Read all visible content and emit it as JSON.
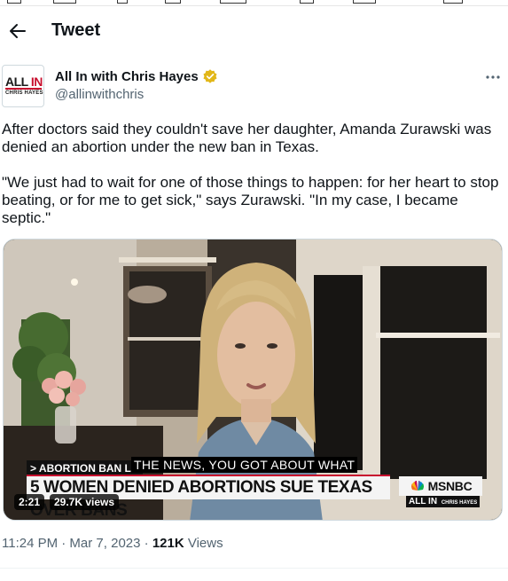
{
  "header": {
    "title": "Tweet",
    "back_icon": "arrow-left-icon"
  },
  "author": {
    "name": "All In with Chris Hayes",
    "handle": "@allinwithchris",
    "verified_icon": "verified-badge-icon",
    "verified_color": "#e2b719",
    "avatar": {
      "logo_top": "ALL IN",
      "logo_bottom": "CHRIS HAYES"
    },
    "more_icon": "more-dots-icon"
  },
  "tweet": {
    "paragraphs": [
      "After doctors said they couldn't save her daughter, Amanda Zurawski was denied an abortion under the new ban in Texas.",
      "\"We just had to wait for one of those things to happen: for her heart to stop beating, or for me to get sick,\" says Zurawski. \"In my case, I became septic.\""
    ]
  },
  "video": {
    "tag": "> ABORTION BAN LA",
    "caption": "THE NEWS, YOU GOT ABOUT WHAT",
    "headline": "5 WOMEN DENIED ABORTIONS SUE TEXAS OVER BANS",
    "network": "MSNBC",
    "show": "ALL IN",
    "show_host": "CHRIS HAYES",
    "duration": "2:21",
    "views": "29.7K views"
  },
  "meta": {
    "timestamp": "11:24 PM · Mar 7, 2023 · ",
    "views_count": "121K",
    "views_label": " Views"
  },
  "colors": {
    "text": "#0f1419",
    "secondary": "#536471",
    "accent_red": "#c8102e"
  }
}
